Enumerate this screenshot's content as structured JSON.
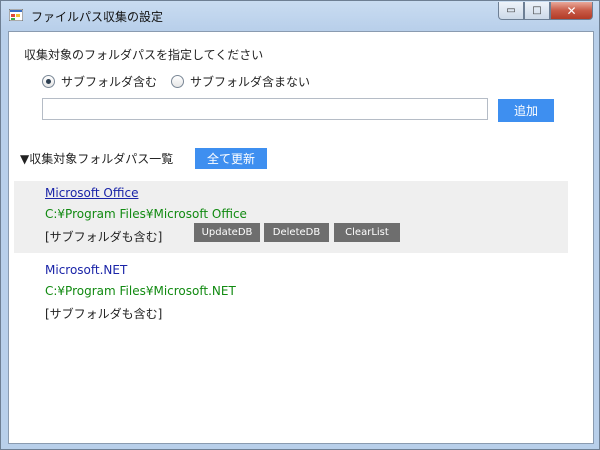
{
  "window": {
    "title": "ファイルパス収集の設定",
    "controls": {
      "minimize": "▭",
      "maximize": "□",
      "close": "✕"
    }
  },
  "form": {
    "instruction": "収集対象のフォルダパスを指定してください",
    "radio_options": [
      {
        "label": "サブフォルダ含む",
        "selected": true
      },
      {
        "label": "サブフォルダ含まない",
        "selected": false
      }
    ],
    "path_input": {
      "value": "",
      "placeholder": ""
    },
    "add_button": "追加"
  },
  "list": {
    "heading": "▼収集対象フォルダパス一覧",
    "refresh_all_button": "全て更新",
    "entries": [
      {
        "name": "Microsoft Office",
        "path": "C:¥Program Files¥Microsoft Office",
        "subfolder_note": "[サブフォルダも含む]",
        "buttons": [
          "UpdateDB",
          "DeleteDB",
          "ClearList"
        ]
      },
      {
        "name": "Microsoft.NET",
        "path": "C:¥Program Files¥Microsoft.NET",
        "subfolder_note": "[サブフォルダも含む]"
      }
    ]
  },
  "colors": {
    "accent_button": "#3e8ff0",
    "gray_button": "#6e6e6e",
    "link_text": "#1a24a8",
    "path_text": "#118a11",
    "selected_row_bg": "#efefef"
  }
}
